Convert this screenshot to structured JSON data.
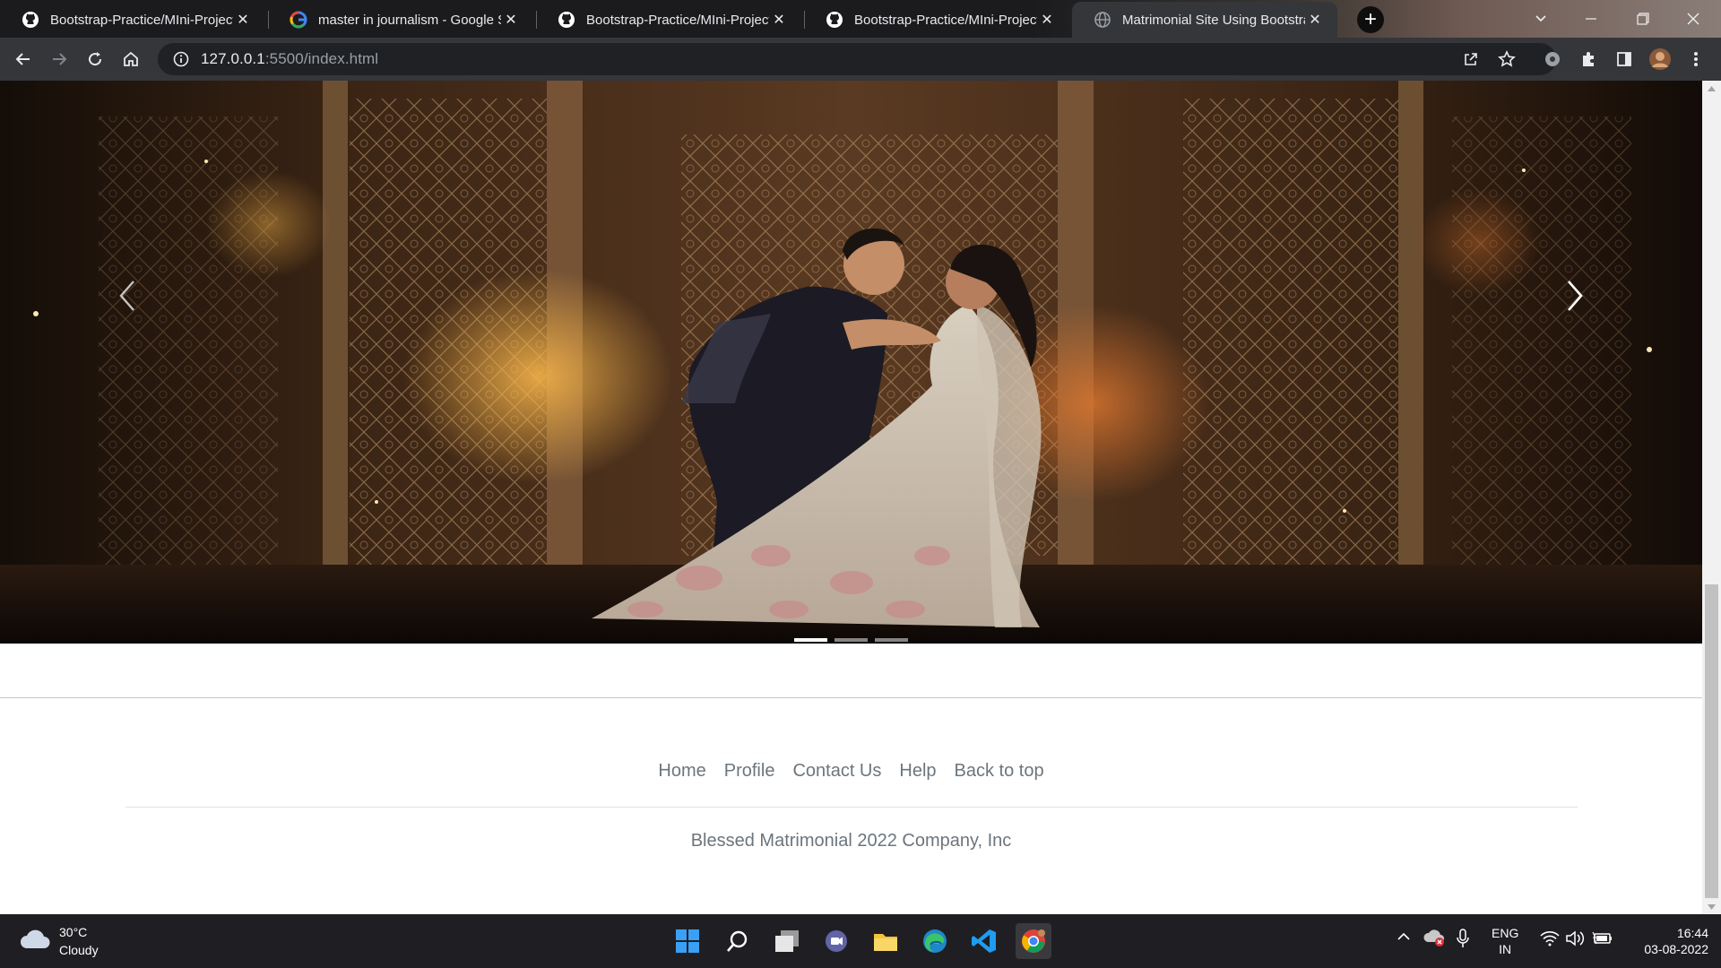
{
  "browser": {
    "tabs": [
      {
        "title": "Bootstrap-Practice/MIni-Project_",
        "icon": "github-icon",
        "active": false
      },
      {
        "title": "master in journalism - Google Se",
        "icon": "google-icon",
        "active": false
      },
      {
        "title": "Bootstrap-Practice/MIni-Project_",
        "icon": "github-icon",
        "active": false
      },
      {
        "title": "Bootstrap-Practice/MIni-Project_",
        "icon": "github-icon",
        "active": false
      },
      {
        "title": "Matrimonial Site Using Bootstrap",
        "icon": "globe-icon",
        "active": true
      }
    ],
    "close_glyph": "✕",
    "new_tab_glyph": "+",
    "url_host": "127.0.0.1",
    "url_path": ":5500/index.html"
  },
  "carousel": {
    "slide_count": 3,
    "active_slide": 1,
    "prev_glyph": "‹",
    "next_glyph": "›"
  },
  "footer": {
    "nav": [
      "Home",
      "Profile",
      "Contact Us",
      "Help",
      "Back to top"
    ],
    "copyright": "Blessed Matrimonial 2022 Company, Inc"
  },
  "taskbar": {
    "weather_temp": "30°C",
    "weather_desc": "Cloudy",
    "apps": [
      "windows-start-icon",
      "search-icon",
      "task-view-icon",
      "teams-chat-icon",
      "file-explorer-icon",
      "edge-icon",
      "vscode-icon",
      "chrome-icon"
    ],
    "lang_line1": "ENG",
    "lang_line2": "IN",
    "time": "16:44",
    "date": "03-08-2022"
  },
  "colors": {
    "footer_text": "#6c757d",
    "chrome_toolbar": "#35363a",
    "taskbar": "#1f1f23"
  }
}
